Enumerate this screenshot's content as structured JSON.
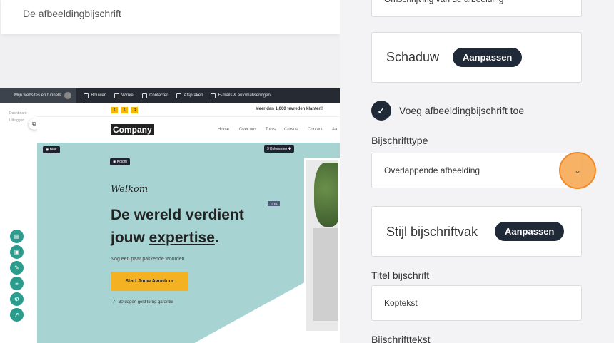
{
  "canvas": {
    "caption_card_text": "De afbeeldingbijschrift",
    "topbar": {
      "websites_chip": "Mijn websites en funnels",
      "items": [
        "Bouwen",
        "Winkel",
        "Contacten",
        "Afspraken",
        "E-mails & automatiseringen"
      ]
    },
    "sidenav": {
      "dashboard": "Dashboard",
      "logout": "Uitloggen"
    },
    "site": {
      "promo": "Meer dan 1,000 tevreden klanten!",
      "logo": "Company",
      "nav": [
        "Home",
        "Over ons",
        "Tools",
        "Cursus",
        "Contact",
        "Aa"
      ],
      "blok_badge": "Blok",
      "kolom_badge": "Kolom",
      "kolommen_badge": "Kolommen",
      "kolommen_count": "3",
      "welkom": "Welkom",
      "headline_line1": "De wereld verdient",
      "headline_line2_prefix": "jouw ",
      "headline_line2_underlined": "expertise",
      "headline_line2_suffix": ".",
      "subtitle": "Nog een paar pakkende woorden",
      "cta": "Start Jouw Avontuur",
      "guarantee": "30 dagen geld terug garantie",
      "titel_tag": "TITEL"
    }
  },
  "panel": {
    "top_input_value": "Omschrijving van de afbeelding",
    "shadow_label": "Schaduw",
    "shadow_button": "Aanpassen",
    "add_caption_label": "Voeg afbeeldingbijschrift toe",
    "caption_type_label": "Bijschrifttype",
    "caption_type_value": "Overlappende afbeelding",
    "style_label": "Stijl bijschriftvak",
    "style_button": "Aanpassen",
    "title_label": "Titel bijschrift",
    "title_value": "Koptekst",
    "text_label": "Bijschrifttekst"
  },
  "colors": {
    "accent_dark": "#1f2937",
    "highlight_orange": "#f7a54a",
    "hero_teal": "#a8d3d3",
    "cta_yellow": "#f4b223",
    "tool_green": "#2b9b8c"
  }
}
